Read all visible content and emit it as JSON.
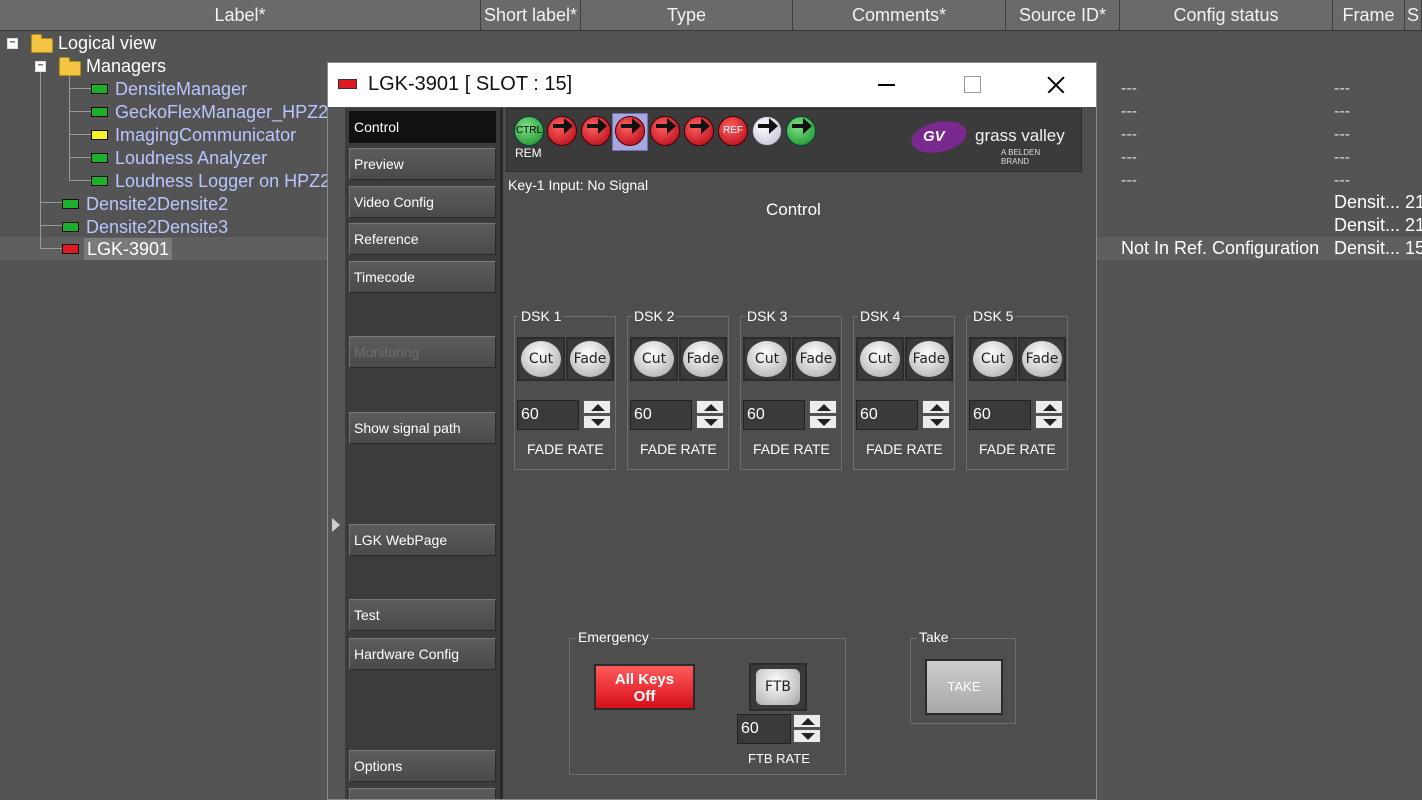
{
  "grid": {
    "columns": [
      "Label*",
      "Short label*",
      "Type",
      "Comments*",
      "Source ID*",
      "Config status",
      "Frame",
      "S"
    ],
    "tree": [
      {
        "label": "Logical view"
      },
      {
        "label": "Managers"
      },
      {
        "label": "DensiteManager"
      },
      {
        "label": "GeckoFlexManager_HPZ2M"
      },
      {
        "label": "ImagingCommunicator"
      },
      {
        "label": "Loudness Analyzer"
      },
      {
        "label": "Loudness Logger on HPZ2"
      },
      {
        "label": "Densite2Densite2"
      },
      {
        "label": "Densite2Densite3"
      },
      {
        "label": "LGK-3901"
      }
    ],
    "config_dashes": [
      "---",
      "---",
      "---",
      "---",
      "---"
    ],
    "frame_dashes": [
      "---",
      "---",
      "---",
      "---",
      "---"
    ],
    "row_d2": {
      "frame": "Densit...",
      "s": "21"
    },
    "row_d3": {
      "frame": "Densit...",
      "s": "21"
    },
    "row_lgk": {
      "config_status": "Not In Ref. Configuration",
      "frame": "Densit...",
      "s": "15"
    }
  },
  "dialog": {
    "title": "LGK-3901 [ SLOT : 15]",
    "nav": {
      "control": "Control",
      "preview": "Preview",
      "video_config": "Video Config",
      "reference": "Reference",
      "timecode": "Timecode",
      "monitoring": "Monitoring",
      "show_signal_path": "Show signal path",
      "webpage": "LGK WebPage",
      "test": "Test",
      "hardware_config": "Hardware Config",
      "options": "Options"
    },
    "status": {
      "ctrl_label": "CTRL",
      "rem_label": "REM",
      "ref_label": "REF"
    },
    "brand": {
      "logo_text": "GV",
      "name": "grass valley",
      "sub": "A BELDEN BRAND"
    },
    "key_input": "Key-1 Input: No Signal",
    "section_title": "Control",
    "dsk": [
      {
        "title": "DSK 1",
        "cut": "Cut",
        "fade": "Fade",
        "rate": "60",
        "rate_label": "FADE RATE"
      },
      {
        "title": "DSK 2",
        "cut": "Cut",
        "fade": "Fade",
        "rate": "60",
        "rate_label": "FADE RATE"
      },
      {
        "title": "DSK 3",
        "cut": "Cut",
        "fade": "Fade",
        "rate": "60",
        "rate_label": "FADE RATE"
      },
      {
        "title": "DSK 4",
        "cut": "Cut",
        "fade": "Fade",
        "rate": "60",
        "rate_label": "FADE RATE"
      },
      {
        "title": "DSK 5",
        "cut": "Cut",
        "fade": "Fade",
        "rate": "60",
        "rate_label": "FADE RATE"
      }
    ],
    "emergency": {
      "title": "Emergency",
      "all_keys_off_1": "All Keys",
      "all_keys_off_2": "Off",
      "ftb": "FTB",
      "ftb_rate": "60",
      "ftb_rate_label": "FTB RATE"
    },
    "take": {
      "title": "Take",
      "button": "TAKE"
    }
  }
}
